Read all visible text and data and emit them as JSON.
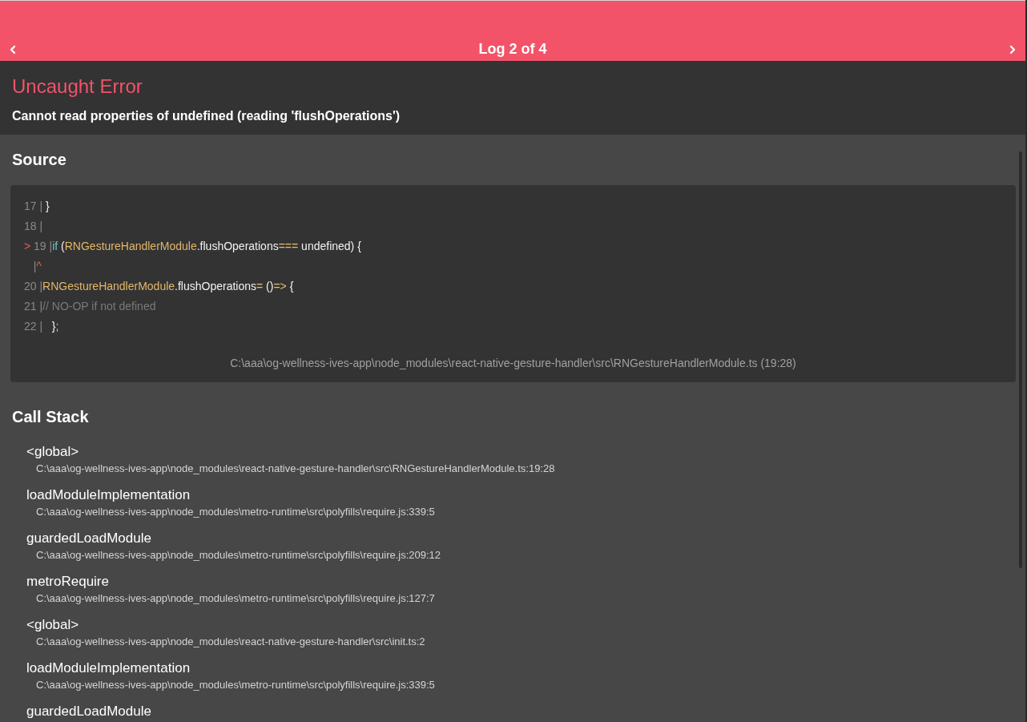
{
  "header": {
    "title": "Log 2 of 4"
  },
  "error": {
    "title": "Uncaught Error",
    "message": "Cannot read properties of undefined (reading 'flushOperations')"
  },
  "source": {
    "title": "Source",
    "lines": [
      {
        "segments": [
          {
            "kind": "gutter",
            "text": "17 |"
          },
          {
            "kind": "plain",
            "text": " }"
          }
        ]
      },
      {
        "segments": [
          {
            "kind": "gutter",
            "text": "18 |"
          }
        ]
      },
      {
        "segments": [
          {
            "kind": "pointer",
            "text": "> "
          },
          {
            "kind": "gutter",
            "text": "19 |"
          },
          {
            "kind": "keyword",
            "text": "if"
          },
          {
            "kind": "plain",
            "text": " ("
          },
          {
            "kind": "identifier",
            "text": "RNGestureHandlerModule"
          },
          {
            "kind": "plain",
            "text": ".flushOperations"
          },
          {
            "kind": "operator",
            "text": "==="
          },
          {
            "kind": "plain",
            "text": " undefined) {"
          }
        ]
      },
      {
        "segments": [
          {
            "kind": "gutter",
            "text": "   |"
          },
          {
            "kind": "marker",
            "text": "^"
          }
        ]
      },
      {
        "segments": [
          {
            "kind": "gutter",
            "text": "20 |"
          },
          {
            "kind": "identifier",
            "text": "RNGestureHandlerModule"
          },
          {
            "kind": "plain",
            "text": ".flushOperations"
          },
          {
            "kind": "operator",
            "text": "="
          },
          {
            "kind": "plain",
            "text": " ()"
          },
          {
            "kind": "operator",
            "text": "=>"
          },
          {
            "kind": "plain",
            "text": " {"
          }
        ]
      },
      {
        "segments": [
          {
            "kind": "gutter",
            "text": "21 |"
          },
          {
            "kind": "comment",
            "text": "// NO-OP if not defined"
          }
        ]
      },
      {
        "segments": [
          {
            "kind": "gutter",
            "text": "22 |"
          },
          {
            "kind": "plain",
            "text": "   }"
          },
          {
            "kind": "operator",
            "text": ";"
          }
        ]
      }
    ],
    "location": "C:\\aaa\\og-wellness-ives-app\\node_modules\\react-native-gesture-handler\\src\\RNGestureHandlerModule.ts (19:28)"
  },
  "call_stack": {
    "title": "Call Stack",
    "frames": [
      {
        "method": "<global>",
        "file": "C:\\aaa\\og-wellness-ives-app\\node_modules\\react-native-gesture-handler\\src\\RNGestureHandlerModule.ts:19:28"
      },
      {
        "method": "loadModuleImplementation",
        "file": "C:\\aaa\\og-wellness-ives-app\\node_modules\\metro-runtime\\src\\polyfills\\require.js:339:5"
      },
      {
        "method": "guardedLoadModule",
        "file": "C:\\aaa\\og-wellness-ives-app\\node_modules\\metro-runtime\\src\\polyfills\\require.js:209:12"
      },
      {
        "method": "metroRequire",
        "file": "C:\\aaa\\og-wellness-ives-app\\node_modules\\metro-runtime\\src\\polyfills\\require.js:127:7"
      },
      {
        "method": "<global>",
        "file": "C:\\aaa\\og-wellness-ives-app\\node_modules\\react-native-gesture-handler\\src\\init.ts:2"
      },
      {
        "method": "loadModuleImplementation",
        "file": "C:\\aaa\\og-wellness-ives-app\\node_modules\\metro-runtime\\src\\polyfills\\require.js:339:5"
      },
      {
        "method": "guardedLoadModule"
      }
    ]
  }
}
